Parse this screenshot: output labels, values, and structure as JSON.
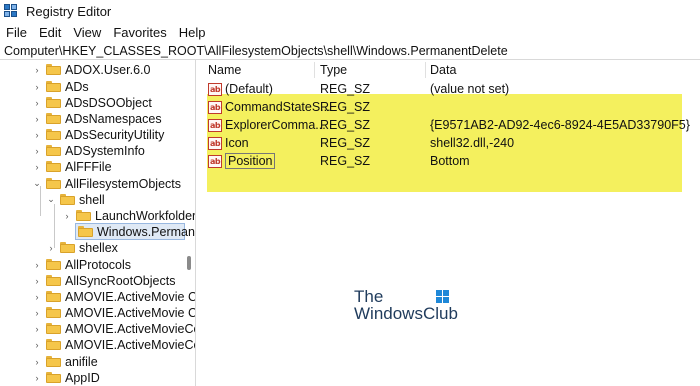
{
  "window": {
    "title": "Registry Editor"
  },
  "menu": [
    "File",
    "Edit",
    "View",
    "Favorites",
    "Help"
  ],
  "address": "Computer\\HKEY_CLASSES_ROOT\\AllFilesystemObjects\\shell\\Windows.PermanentDelete",
  "tree": [
    {
      "label": "ADOX.User.6.0"
    },
    {
      "label": "ADs"
    },
    {
      "label": "ADsDSOObject"
    },
    {
      "label": "ADsNamespaces"
    },
    {
      "label": "ADsSecurityUtility"
    },
    {
      "label": "ADSystemInfo"
    },
    {
      "label": "AlFFFile"
    },
    {
      "label": "AllFilesystemObjects"
    },
    {
      "label": "shell"
    },
    {
      "label": "LaunchWorkfolder"
    },
    {
      "label": "Windows.Permane"
    },
    {
      "label": "shellex"
    },
    {
      "label": "AllProtocols"
    },
    {
      "label": "AllSyncRootObjects"
    },
    {
      "label": "AMOVIE.ActiveMovie Co"
    },
    {
      "label": "AMOVIE.ActiveMovie Co"
    },
    {
      "label": "AMOVIE.ActiveMovieCo"
    },
    {
      "label": "AMOVIE.ActiveMovieCo"
    },
    {
      "label": "anifile"
    },
    {
      "label": "AppID"
    }
  ],
  "columns": {
    "name": "Name",
    "type": "Type",
    "data": "Data"
  },
  "values": [
    {
      "name": "(Default)",
      "type": "REG_SZ",
      "data": "(value not set)"
    },
    {
      "name": "CommandStateS...",
      "type": "REG_SZ",
      "data": ""
    },
    {
      "name": "ExplorerComma...",
      "type": "REG_SZ",
      "data": "{E9571AB2-AD92-4ec6-8924-4E5AD33790F5}"
    },
    {
      "name": "Icon",
      "type": "REG_SZ",
      "data": "shell32.dll,-240"
    },
    {
      "name": "Position",
      "type": "REG_SZ",
      "data": "Bottom"
    }
  ],
  "icons": {
    "value": "ab"
  },
  "watermark": {
    "line1": "The",
    "line2": "WindowsClub"
  },
  "colors": {
    "highlight": "#f4f05e",
    "folder": "#f5c64a",
    "selection": "#dfe9f5"
  }
}
